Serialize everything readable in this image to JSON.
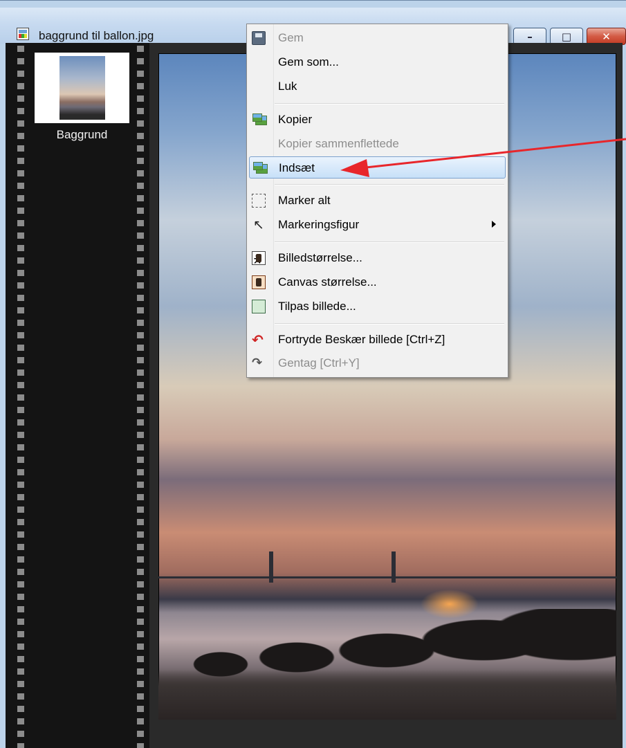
{
  "window": {
    "title": "baggrund til ballon.jpg",
    "buttons": {
      "minimize": "–",
      "maximize": "□",
      "close": "✕"
    }
  },
  "filmstrip": {
    "items": [
      {
        "label": "Baggrund"
      }
    ]
  },
  "context_menu": {
    "items": [
      {
        "label": "Gem",
        "icon": "save-icon",
        "disabled": true
      },
      {
        "label": "Gem som...",
        "icon": "",
        "disabled": false
      },
      {
        "label": "Luk",
        "icon": "",
        "disabled": false
      },
      {
        "label": "Kopier",
        "icon": "copy-image-icon",
        "disabled": false
      },
      {
        "label": "Kopier sammenflettede",
        "icon": "",
        "disabled": true
      },
      {
        "label": "Indsæt",
        "icon": "paste-image-icon",
        "disabled": false,
        "highlighted": true
      },
      {
        "label": "Marker alt",
        "icon": "select-all-icon",
        "disabled": false
      },
      {
        "label": "Markeringsfigur",
        "icon": "pointer-icon",
        "disabled": false,
        "submenu": true
      },
      {
        "label": "Billedstørrelse...",
        "icon": "image-size-icon",
        "disabled": false
      },
      {
        "label": "Canvas størrelse...",
        "icon": "canvas-size-icon",
        "disabled": false
      },
      {
        "label": "Tilpas billede...",
        "icon": "fit-image-icon",
        "disabled": false
      },
      {
        "label": "Fortryde Beskær billede [Ctrl+Z]",
        "icon": "undo-icon",
        "disabled": false
      },
      {
        "label": "Gentag [Ctrl+Y]",
        "icon": "redo-icon",
        "disabled": true
      }
    ]
  },
  "annotation": {
    "arrow_color": "#e8262b"
  },
  "colors": {
    "highlight_border": "#7da2ce",
    "disabled_text": "#8d8d8d"
  }
}
